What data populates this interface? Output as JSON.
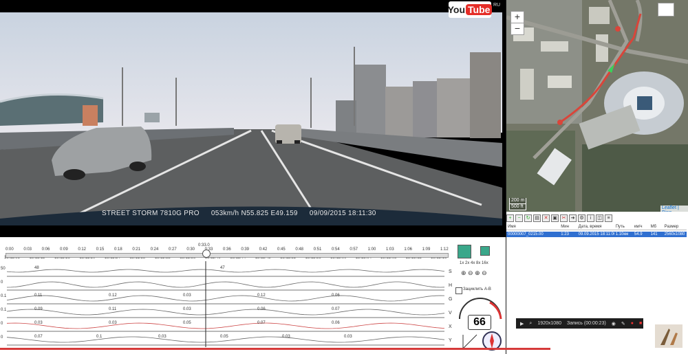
{
  "video": {
    "model": "STREET STORM 7810G PRO",
    "telemetry": "053km/h N55.825 E49.159",
    "datetime": "09/09/2015 18:11:30"
  },
  "youtube": {
    "you": "You",
    "tube": "Tube",
    "region": "RU"
  },
  "map": {
    "zoom_in": "+",
    "zoom_out": "−",
    "scale_m": "200 m",
    "scale_ft": "500 ft",
    "attribution": "Leaflet | Bing"
  },
  "files": {
    "columns": [
      "Имя",
      "Мин",
      "Дата, время",
      "Путь",
      "км/ч",
      "Мб",
      "Размер"
    ],
    "row": [
      "00000007_0215.00",
      "1:23",
      "09.09.2015 18:11:00",
      "1.10км",
      "54.9",
      "141",
      "2560x1080"
    ]
  },
  "timeline": {
    "time_ticks": [
      "0:00",
      "0:03",
      "0:06",
      "0:09",
      "0:12",
      "0:15",
      "0:18",
      "0:21",
      "0:24",
      "0:27",
      "0:30",
      "0:33",
      "0:36",
      "0:39",
      "0:42",
      "0:45",
      "0:48",
      "0:51",
      "0:54",
      "0:57",
      "1:00",
      "1:03",
      "1:06",
      "1:09",
      "1:12"
    ],
    "clock_ticks": [
      "18:11:08",
      "18:11:12",
      "18:11:16",
      "18:11:20",
      "18:11:24",
      "18:11:28",
      "18:11:32",
      "18:11:36",
      "18:11:40",
      "18:11:44",
      "18:11:48",
      "18:11:52",
      "18:11:56",
      "18:12:00",
      "18:12:04",
      "18:12:08",
      "18:12:12",
      "18:12:16"
    ],
    "current_time": "0:33.0",
    "tracks": [
      {
        "name": "S",
        "left_scale": "50",
        "labels": [
          "48",
          "47"
        ]
      },
      {
        "name": "H",
        "left_scale": "0",
        "labels": []
      },
      {
        "name": "G",
        "left_scale": "0.1",
        "labels": [
          "0.11",
          "0.12",
          "0.03",
          "0.12",
          "0.06"
        ]
      },
      {
        "name": "V",
        "left_scale": "0.1",
        "labels": [
          "0.09",
          "0.11",
          "0.03",
          "0.06",
          "0.07"
        ]
      },
      {
        "name": "X",
        "left_scale": "0",
        "labels": [
          "0.03",
          "0.03",
          "0.05",
          "0.07",
          "0.06"
        ]
      },
      {
        "name": "Y",
        "left_scale": "0",
        "labels": [
          "0.07",
          "0.1",
          "0.03",
          "0.05",
          "0.03",
          "0.03"
        ]
      }
    ],
    "loop_label": "Зациклить А-В",
    "speed_value": "66"
  },
  "record_bar": {
    "resolution": "1920x1080",
    "record": "Запись (00:00:23)"
  }
}
